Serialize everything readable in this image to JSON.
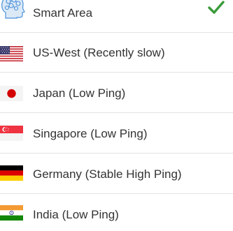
{
  "servers": [
    {
      "label": "Smart Area",
      "icon": "brain-head-icon",
      "selected": true
    },
    {
      "label": "US-West (Recently slow)",
      "icon": "us-flag-icon",
      "selected": false
    },
    {
      "label": "Japan (Low Ping)",
      "icon": "japan-flag-icon",
      "selected": false
    },
    {
      "label": "Singapore (Low Ping)",
      "icon": "singapore-flag-icon",
      "selected": false
    },
    {
      "label": "Germany (Stable High Ping)",
      "icon": "germany-flag-icon",
      "selected": false
    },
    {
      "label": "India (Low Ping)",
      "icon": "india-flag-icon",
      "selected": false
    }
  ],
  "colors": {
    "check": "#3a9b3a",
    "brain": "#4a90d9",
    "text": "#333333"
  }
}
